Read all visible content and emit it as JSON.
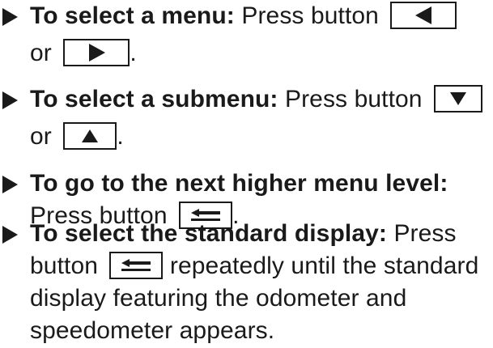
{
  "instructions": [
    {
      "heading": "To select a menu:",
      "lines": [
        {
          "text": "Press button",
          "key": "left-arrow"
        },
        {
          "prefix": "or",
          "key": "right-arrow",
          "suffix": "."
        }
      ]
    },
    {
      "heading": "To select a submenu:",
      "lines": [
        {
          "text": "Press button",
          "key": "down-arrow"
        },
        {
          "prefix": "or",
          "key": "up-arrow",
          "suffix": "."
        }
      ]
    },
    {
      "heading": "To go to the next higher menu level:",
      "lines": [
        {
          "text": "Press button",
          "key": "back",
          "suffix": "."
        }
      ]
    },
    {
      "heading": "To select the standard display:",
      "lines": [
        {
          "text": "Press"
        },
        {
          "prefix": "button",
          "key": "back",
          "suffix": "repeatedly until the standard"
        },
        {
          "text": "display featuring the odometer and"
        },
        {
          "text": "speedometer appears."
        }
      ]
    }
  ],
  "icons": {
    "bullet": "triangle-bullet-icon",
    "left": "left-arrow-icon",
    "right": "right-arrow-icon",
    "down": "down-arrow-icon",
    "up": "up-arrow-icon",
    "back": "back-icon"
  }
}
